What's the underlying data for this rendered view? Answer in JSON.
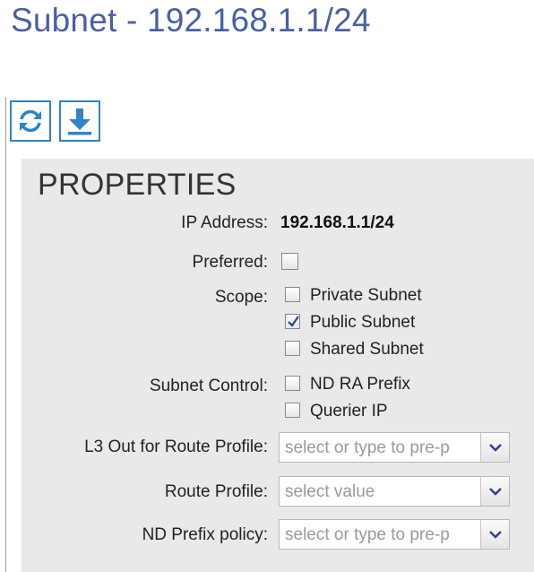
{
  "page": {
    "title": "Subnet - 192.168.1.1/24"
  },
  "toolbar": {
    "refresh_icon": "refresh-icon",
    "download_icon": "download-icon",
    "accent": "#2f83c8"
  },
  "properties": {
    "heading": "PROPERTIES",
    "ip_address": {
      "label": "IP Address:",
      "value": "192.168.1.1/24"
    },
    "preferred": {
      "label": "Preferred:",
      "checked": false
    },
    "scope": {
      "label": "Scope:",
      "options": [
        {
          "label": "Private Subnet",
          "checked": false
        },
        {
          "label": "Public Subnet",
          "checked": true
        },
        {
          "label": "Shared Subnet",
          "checked": false
        }
      ]
    },
    "subnet_control": {
      "label": "Subnet Control:",
      "options": [
        {
          "label": "ND RA Prefix",
          "checked": false
        },
        {
          "label": "Querier IP",
          "checked": false
        }
      ]
    },
    "l3out_route_profile": {
      "label": "L3 Out for Route Profile:",
      "placeholder": "select or type to pre-p"
    },
    "route_profile": {
      "label": "Route Profile:",
      "placeholder": "select value"
    },
    "nd_prefix_policy": {
      "label": "ND Prefix policy:",
      "placeholder": "select or type to pre-p"
    }
  }
}
